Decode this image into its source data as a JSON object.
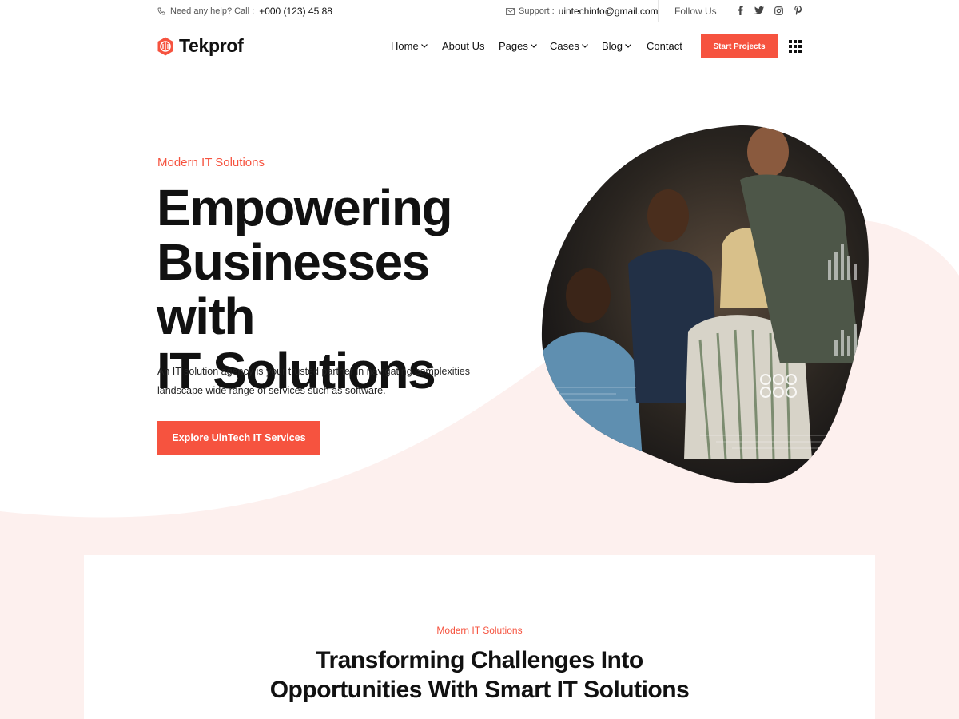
{
  "topbar": {
    "help_label": "Need any help? Call :",
    "phone": "+000 (123) 45 88",
    "support_label": "Support :",
    "email": "uintechinfo@gmail.com",
    "follow_label": "Follow Us",
    "social": [
      "facebook-icon",
      "twitter-icon",
      "instagram-icon",
      "pinterest-icon"
    ]
  },
  "brand": {
    "name": "Tekprof",
    "accent": "#f6533f"
  },
  "nav": {
    "items": [
      {
        "label": "Home",
        "dropdown": true
      },
      {
        "label": "About Us",
        "dropdown": false
      },
      {
        "label": "Pages",
        "dropdown": true
      },
      {
        "label": "Cases",
        "dropdown": true
      },
      {
        "label": "Blog",
        "dropdown": true
      },
      {
        "label": "Contact",
        "dropdown": false
      }
    ],
    "cta": "Start Projects"
  },
  "hero": {
    "eyebrow": "Modern IT Solutions",
    "title_line1": "Empowering",
    "title_line2": "Businesses with",
    "title_line3": "IT Solutions",
    "description": "An IT solution agency is your trusted partner in navigating complexities landscape wide range of services such as software.",
    "button": "Explore UinTech IT Services"
  },
  "section": {
    "eyebrow": "Modern IT Solutions",
    "title_line1": "Transforming Challenges Into",
    "title_line2": "Opportunities With Smart IT Solutions"
  }
}
